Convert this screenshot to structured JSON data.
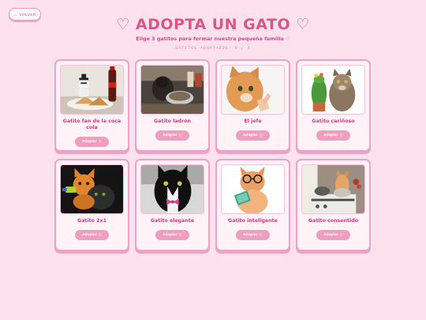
{
  "back_label": "VOLVER",
  "title": "♡ ADOPTA UN GATO ♡",
  "subtitle": "Elige 3 gatitos para formar nuestra pequeña familia ♡",
  "counter": "GATITOS ADOPTADOS: 0 / 3",
  "adopt_label": "Adoptar",
  "colors": {
    "background": "#fde2ee",
    "accent": "#d9558c",
    "button": "#ee9fbf",
    "card_border": "#eda3c3"
  },
  "cats": [
    {
      "name": "Gatito fan de la coca cola",
      "photo": "cat-with-cola"
    },
    {
      "name": "Gatito ladrón",
      "photo": "cat-in-kitchen"
    },
    {
      "name": "El jefe",
      "photo": "orange-cat-closeup"
    },
    {
      "name": "Gatito cariñoso",
      "photo": "cat-with-cactus-toy"
    },
    {
      "name": "Gatito 2x1",
      "photo": "two-kittens"
    },
    {
      "name": "Gatito elegante",
      "photo": "tuxedo-cat-bowtie"
    },
    {
      "name": "Gatito inteligente",
      "photo": "cat-with-glasses-book"
    },
    {
      "name": "Gatito consentido",
      "photo": "cat-on-stove"
    }
  ]
}
